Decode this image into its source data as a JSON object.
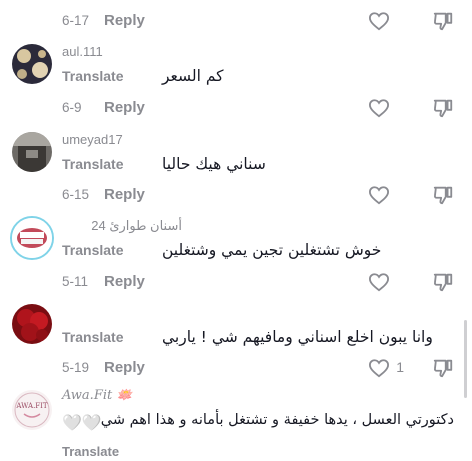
{
  "comments": [
    {
      "username": "",
      "text": "",
      "date": "6-17",
      "reply": "Reply",
      "likes": ""
    },
    {
      "username": "aul.111",
      "translate": "Translate",
      "text": "كم السعر",
      "date": "6-9",
      "reply": "Reply",
      "likes": ""
    },
    {
      "username": "umeyad17",
      "translate": "Translate",
      "text": "سناني هيك حاليا",
      "date": "6-15",
      "reply": "Reply",
      "likes": ""
    },
    {
      "username": "أسنان طوارئ 24",
      "translate": "Translate",
      "text": "خوش تشتغلين تجين يمي وشتغلين",
      "date": "5-11",
      "reply": "Reply",
      "likes": ""
    },
    {
      "username": "",
      "translate": "Translate",
      "text": "وانا يبون اخلع اسناني ومافيهم شي ! ياربي",
      "date": "5-19",
      "reply": "Reply",
      "likes": "1"
    },
    {
      "username": "Awa.Fit 🪷",
      "translate": "Translate",
      "text": "دكتورتي العسل ، يدها خفيفة و تشتغل بأمانه و هذا اهم شيء",
      "hearts": "🤍🤍"
    }
  ],
  "colors": {
    "meta_gray": "#8a8b91",
    "text": "#161823"
  },
  "icons": [
    "heart-outline-icon",
    "thumbs-down-outline-icon",
    "heart-emoji-icon"
  ]
}
